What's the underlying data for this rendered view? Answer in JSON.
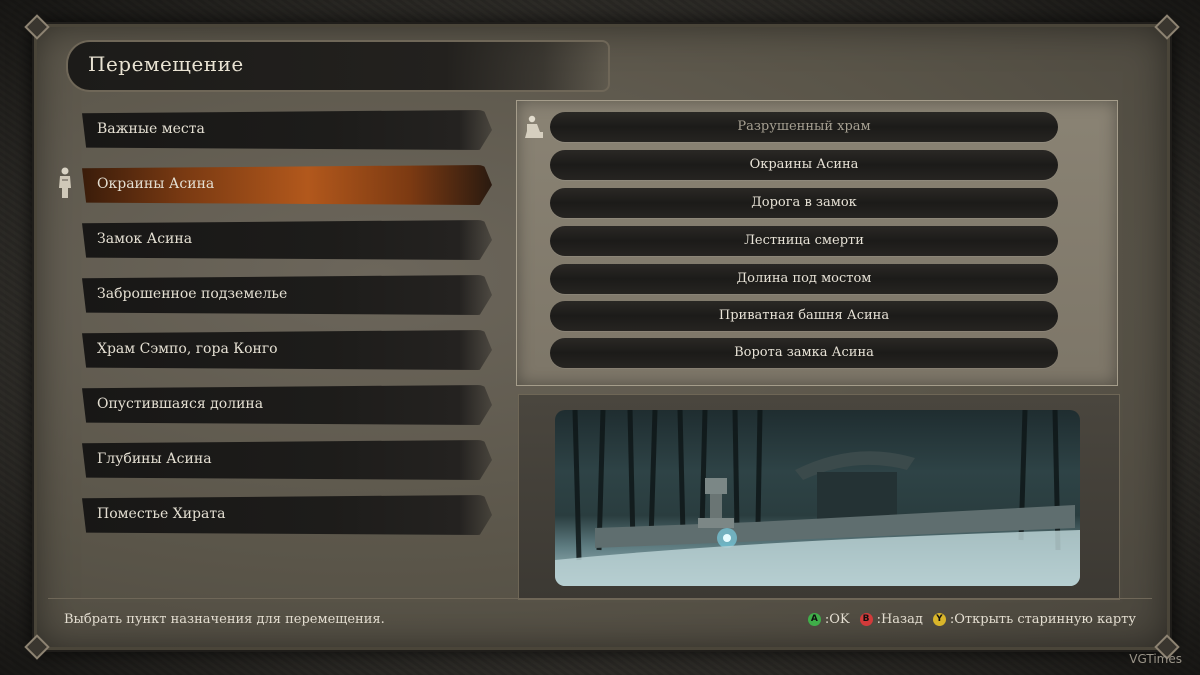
{
  "header": {
    "title": "Перемещение"
  },
  "left_list": {
    "items": [
      {
        "label": "Важные места",
        "active": false
      },
      {
        "label": "Окраины Асина",
        "active": true
      },
      {
        "label": "Замок Асина",
        "active": false
      },
      {
        "label": "Заброшенное подземелье",
        "active": false
      },
      {
        "label": "Храм Сэмпо, гора Конго",
        "active": false
      },
      {
        "label": "Опустившаяся долина",
        "active": false
      },
      {
        "label": "Глубины Асина",
        "active": false
      },
      {
        "label": "Поместье Хирата",
        "active": false
      }
    ]
  },
  "right_list": {
    "items": [
      {
        "label": "Разрушенный храм",
        "dim": true
      },
      {
        "label": "Окраины Асина",
        "dim": false
      },
      {
        "label": "Дорога в замок",
        "dim": false
      },
      {
        "label": "Лестница смерти",
        "dim": false
      },
      {
        "label": "Долина под мостом",
        "dim": false
      },
      {
        "label": "Приватная башня Асина",
        "dim": false
      },
      {
        "label": "Ворота замка Асина",
        "dim": false
      }
    ]
  },
  "footer": {
    "hint": "Выбрать пункт назначения для перемещения.",
    "controls": {
      "a_glyph": "A",
      "a_label": ":OK",
      "b_glyph": "B",
      "b_label": ":Назад",
      "y_glyph": "Y",
      "y_label": ":Открыть старинную карту"
    }
  },
  "watermark": "VGTimes",
  "colors": {
    "active_orange": "#b2581c",
    "a_button": "#3fae49",
    "b_button": "#d23a3a",
    "y_button": "#d9b52a"
  },
  "icons": {
    "left_cursor": "idol-statue-icon",
    "right_cursor": "kneeling-statue-icon"
  }
}
